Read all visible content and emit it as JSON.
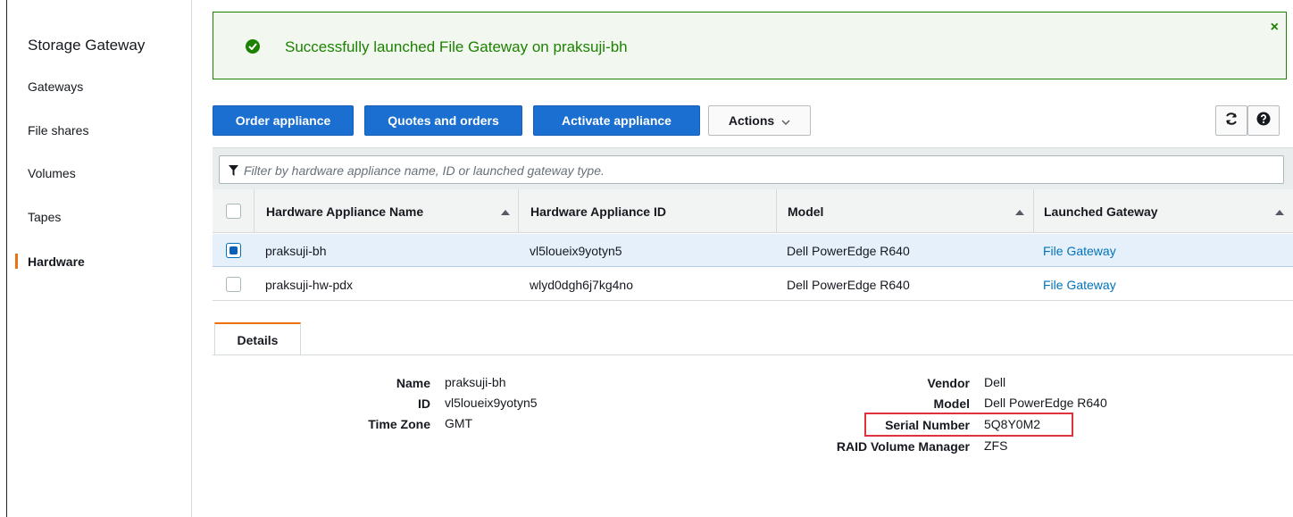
{
  "sidebar": {
    "title": "Storage Gateway",
    "items": [
      {
        "label": "Gateways"
      },
      {
        "label": "File shares"
      },
      {
        "label": "Volumes"
      },
      {
        "label": "Tapes"
      },
      {
        "label": "Hardware"
      }
    ]
  },
  "flash": {
    "message": "Successfully launched File Gateway on praksuji-bh",
    "close": "×"
  },
  "toolbar": {
    "order_label": "Order appliance",
    "quotes_label": "Quotes and orders",
    "activate_label": "Activate appliance",
    "actions_label": "Actions",
    "actions_chevron": "⌵"
  },
  "filter": {
    "placeholder": "Filter by hardware appliance name, ID or launched gateway type."
  },
  "table": {
    "columns": [
      "Hardware Appliance Name",
      "Hardware Appliance ID",
      "Model",
      "Launched Gateway"
    ],
    "rows": [
      {
        "name": "praksuji-bh",
        "id": "vl5loueix9yotyn5",
        "model": "Dell PowerEdge R640",
        "gateway": "File Gateway",
        "selected": true
      },
      {
        "name": "praksuji-hw-pdx",
        "id": "wlyd0dgh6j7kg4no",
        "model": "Dell PowerEdge R640",
        "gateway": "File Gateway",
        "selected": false
      }
    ]
  },
  "details": {
    "tab": "Details",
    "left": [
      {
        "label": "Name",
        "value": "praksuji-bh"
      },
      {
        "label": "ID",
        "value": "vl5loueix9yotyn5"
      },
      {
        "label": "Time Zone",
        "value": "GMT"
      }
    ],
    "right": [
      {
        "label": "Vendor",
        "value": "Dell"
      },
      {
        "label": "Model",
        "value": "Dell PowerEdge R640"
      },
      {
        "label": "Serial Number",
        "value": "5Q8Y0M2"
      },
      {
        "label": "RAID Volume Manager",
        "value": "ZFS"
      }
    ]
  },
  "colors": {
    "primary": "#1a6fd0",
    "success": "#1d8102",
    "accent": "#ec7211",
    "link": "#0073bb",
    "highlight": "#e0313c"
  },
  "icons": [
    "check-circle-icon",
    "close-icon",
    "refresh-icon",
    "help-icon",
    "filter-icon",
    "sort-icon",
    "chevron-down-icon"
  ]
}
